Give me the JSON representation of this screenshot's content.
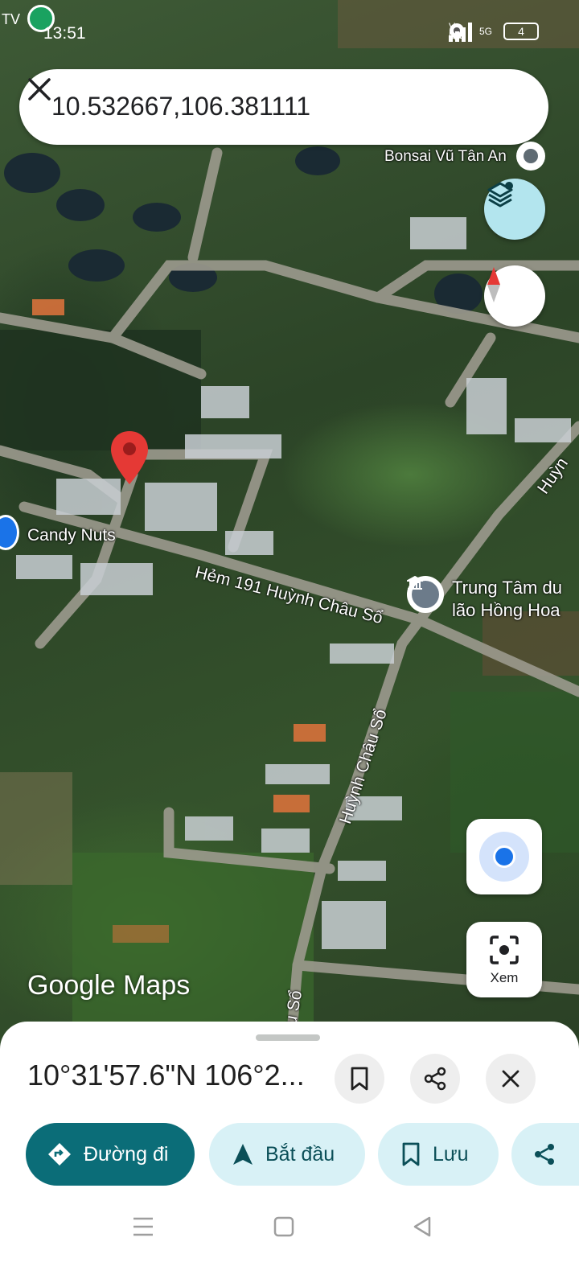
{
  "status_bar": {
    "carrier": "TV",
    "time": "13:51",
    "network_label": "Vo LTE",
    "signal_label": "5G",
    "battery": "4"
  },
  "search": {
    "query": "10.532667,106.381111",
    "close_icon": "close-icon"
  },
  "map": {
    "labels": {
      "bonsai": "Bonsai Vũ Tân An",
      "candy": "Candy Nuts",
      "alley": "Hẻm 191 Huỳnh Châu Sổ",
      "center_line1": "Trung Tâm du",
      "center_line2": "lão Hồng Hoa",
      "street_vertical": "Huỳnh Châu Sổ",
      "street_edge": "Huỳn",
      "street_bottom": "u Sổ"
    },
    "watermark": "Google Maps",
    "controls": {
      "layers_icon": "layers-icon",
      "compass_icon": "compass-icon",
      "my_location_icon": "my-location-icon",
      "lens_label": "Xem"
    },
    "colors": {
      "pin": "#e53935",
      "layers_bg": "#b3e5ee",
      "location_dot": "#1a73e8"
    }
  },
  "sheet": {
    "title": "10°31'57.6\"N 106°2...",
    "actions": {
      "save_icon": "bookmark-icon",
      "share_icon": "share-icon",
      "close_icon": "close-icon"
    },
    "chips": [
      {
        "label": "Đường đi",
        "icon": "directions-icon"
      },
      {
        "label": "Bắt đầu",
        "icon": "navigation-icon"
      },
      {
        "label": "Lưu",
        "icon": "bookmark-icon"
      },
      {
        "label": "",
        "icon": "share-icon"
      }
    ],
    "colors": {
      "primary": "#0b6d78",
      "chip_light": "#d8f1f6"
    }
  },
  "nav_bar": {
    "menu_icon": "menu-icon",
    "home_icon": "home-icon",
    "back_icon": "back-icon"
  }
}
